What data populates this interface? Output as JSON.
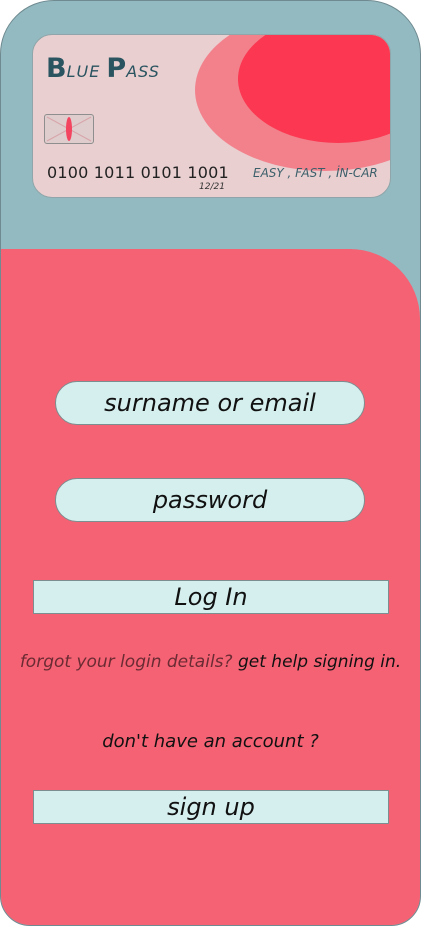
{
  "card": {
    "brand_first_initial": "B",
    "brand_first_rest": "LUE",
    "brand_second_initial": "P",
    "brand_second_rest": "ASS",
    "number": "0100 1011 0101 1001",
    "expiry": "12/21",
    "tagline": "EASY , FAST , İN-CAR",
    "colors": {
      "card": "#e9cfd0",
      "circle_outer": "#f2818c",
      "circle_inner": "#fb3751",
      "brand": "#2a5460"
    }
  },
  "login": {
    "username_placeholder": "surname or email",
    "password_placeholder": "password",
    "login_button": "Log In",
    "forgot_text": "forgot your login details?",
    "help_link": "get help signing in.",
    "no_account_text": "don't have an account ?",
    "signup_button": "sign up"
  },
  "colors": {
    "background": "#93bac1",
    "panel": "#f46274",
    "field": "#d5efee"
  }
}
